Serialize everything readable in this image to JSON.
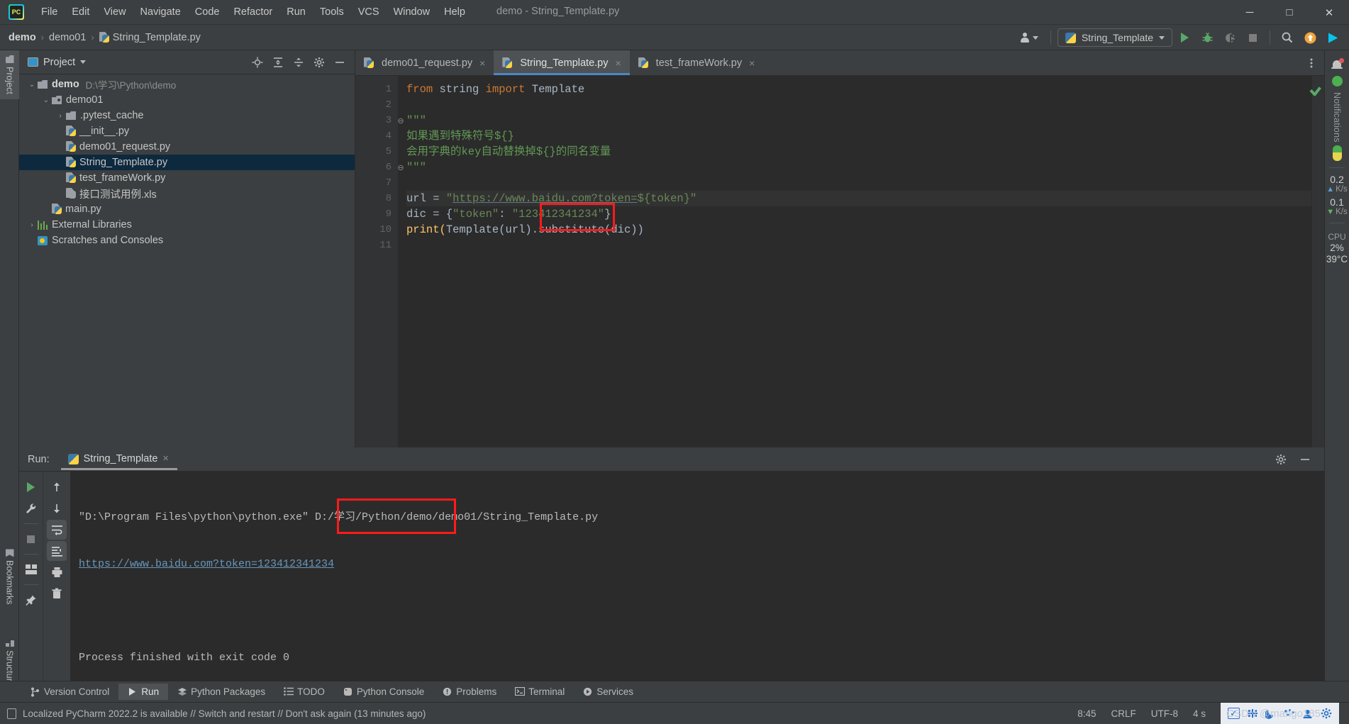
{
  "window": {
    "title": "demo - String_Template.py",
    "controls": {
      "minimize": "─",
      "maximize": "□",
      "close": "✕"
    }
  },
  "menu": {
    "items": [
      "File",
      "Edit",
      "View",
      "Navigate",
      "Code",
      "Refactor",
      "Run",
      "Tools",
      "VCS",
      "Window",
      "Help"
    ]
  },
  "navbar": {
    "breadcrumbs": [
      "demo",
      "demo01",
      "String_Template.py"
    ],
    "run_config": "String_Template",
    "icons": {
      "account": "account-icon",
      "run": "run-icon",
      "debug": "debug-icon",
      "coverage": "run-with-coverage-icon",
      "stop": "stop-icon",
      "search": "search-icon",
      "update": "update-icon",
      "plugin": "ide-features-trainer-icon"
    }
  },
  "left_strip": {
    "top": [
      {
        "label": "Project",
        "icon": "project-folder-icon",
        "active": true
      }
    ],
    "bottom": [
      {
        "label": "Bookmarks",
        "icon": "bookmark-icon",
        "active": false
      },
      {
        "label": "Structure",
        "icon": "structure-icon",
        "active": false
      }
    ]
  },
  "project_panel": {
    "title": "Project",
    "actions": [
      "locate-icon",
      "expand-all-icon",
      "collapse-all-icon",
      "gear-icon",
      "hide-icon"
    ],
    "tree": [
      {
        "depth": 0,
        "arrow": "⌄",
        "icon": "folder",
        "name": "demo",
        "bold": true,
        "path": "D:\\学习\\Python\\demo",
        "selected": false
      },
      {
        "depth": 1,
        "arrow": "⌄",
        "icon": "folder-source",
        "name": "demo01",
        "bold": false,
        "path": "",
        "selected": false
      },
      {
        "depth": 2,
        "arrow": "›",
        "icon": "folder",
        "name": ".pytest_cache",
        "bold": false,
        "path": "",
        "selected": false
      },
      {
        "depth": 2,
        "arrow": "",
        "icon": "python-file",
        "name": "__init__.py",
        "bold": false,
        "path": "",
        "selected": false
      },
      {
        "depth": 2,
        "arrow": "",
        "icon": "python-file",
        "name": "demo01_request.py",
        "bold": false,
        "path": "",
        "selected": false
      },
      {
        "depth": 2,
        "arrow": "",
        "icon": "python-file",
        "name": "String_Template.py",
        "bold": false,
        "path": "",
        "selected": true
      },
      {
        "depth": 2,
        "arrow": "",
        "icon": "python-file",
        "name": "test_frameWork.py",
        "bold": false,
        "path": "",
        "selected": false
      },
      {
        "depth": 2,
        "arrow": "",
        "icon": "unknown-file",
        "name": "接口测试用例.xls",
        "bold": false,
        "path": "",
        "selected": false
      },
      {
        "depth": 1,
        "arrow": "",
        "icon": "python-file",
        "name": "main.py",
        "bold": false,
        "path": "",
        "selected": false
      },
      {
        "depth": 0,
        "arrow": "›",
        "icon": "library",
        "name": "External Libraries",
        "bold": false,
        "path": "",
        "selected": false
      },
      {
        "depth": 0,
        "arrow": "",
        "icon": "scratch",
        "name": "Scratches and Consoles",
        "bold": false,
        "path": "",
        "selected": false
      }
    ]
  },
  "editor": {
    "tabs": [
      {
        "label": "demo01_request.py",
        "active": false
      },
      {
        "label": "String_Template.py",
        "active": true
      },
      {
        "label": "test_frameWork.py",
        "active": false
      }
    ],
    "close_glyph": "×",
    "line_numbers": [
      "1",
      "2",
      "3",
      "4",
      "5",
      "6",
      "7",
      "8",
      "9",
      "10",
      "11"
    ],
    "lines": [
      {
        "n": 1,
        "segments": [
          {
            "t": "from ",
            "c": "k"
          },
          {
            "t": "string ",
            "c": "def"
          },
          {
            "t": "import ",
            "c": "k"
          },
          {
            "t": "Template",
            "c": "def"
          }
        ]
      },
      {
        "n": 2,
        "segments": []
      },
      {
        "n": 3,
        "segments": [
          {
            "t": "\"\"\"",
            "c": "cmt"
          }
        ]
      },
      {
        "n": 4,
        "segments": [
          {
            "t": "如果遇到特殊符号${}",
            "c": "cmt"
          }
        ]
      },
      {
        "n": 5,
        "segments": [
          {
            "t": "会用字典的key自动替换掉${}的同名变量",
            "c": "cmt"
          }
        ]
      },
      {
        "n": 6,
        "segments": [
          {
            "t": "\"\"\"",
            "c": "cmt"
          }
        ]
      },
      {
        "n": 7,
        "segments": []
      },
      {
        "n": 8,
        "segments": [
          {
            "t": "url ",
            "c": "def"
          },
          {
            "t": "= ",
            "c": "def"
          },
          {
            "t": "\"",
            "c": "s"
          },
          {
            "t": "https://www.baidu.com?token=",
            "c": "lnk"
          },
          {
            "t": "${token}\"",
            "c": "s"
          }
        ],
        "current": true
      },
      {
        "n": 9,
        "segments": [
          {
            "t": "dic ",
            "c": "def"
          },
          {
            "t": "= {",
            "c": "def"
          },
          {
            "t": "\"token\"",
            "c": "s"
          },
          {
            "t": ": ",
            "c": "def"
          },
          {
            "t": "\"123412341234\"",
            "c": "s"
          },
          {
            "t": "}",
            "c": "def"
          }
        ]
      },
      {
        "n": 10,
        "segments": [
          {
            "t": "print(",
            "c": "fn"
          },
          {
            "t": "Template(url).substitute(dic))",
            "c": "def"
          }
        ]
      },
      {
        "n": 11,
        "segments": []
      }
    ],
    "fold_markers": {
      "line3": "⊖",
      "line6": "⊖"
    },
    "inspection_status": "ok-check-icon",
    "highlight_box_label": "${token}"
  },
  "run_window": {
    "label": "Run:",
    "tab": "String_Template",
    "tab_close": "×",
    "header_actions": [
      "gear-icon",
      "hide-icon"
    ],
    "left_tools": [
      "rerun-icon",
      "wrench-icon",
      "stop-icon",
      "layout-icon",
      "pin-icon"
    ],
    "right_tools": [
      "up-icon",
      "down-icon",
      "soft-wrap-icon",
      "scroll-to-end-icon",
      "print-icon",
      "trash-icon"
    ],
    "console": {
      "line1": "\"D:\\Program Files\\python\\python.exe\" D:/学习/Python/demo/demo01/String_Template.py",
      "line2_link": "https://www.baidu.com?token=",
      "line2_value": "123412341234",
      "line3": "Process finished with exit code 0"
    }
  },
  "right_strip": {
    "notifications_label": "Notifications",
    "network_up_value": "0.2",
    "network_up_unit": "K/s",
    "network_down_value": "0.1",
    "network_down_unit": "K/s",
    "cpu_label": "CPU",
    "cpu_value": "2%",
    "temperature": "39°C"
  },
  "bottom_bar": {
    "items": [
      {
        "label": "Version Control",
        "icon": "branch-icon",
        "active": false
      },
      {
        "label": "Run",
        "icon": "run-icon",
        "active": true
      },
      {
        "label": "Python Packages",
        "icon": "packages-icon",
        "active": false
      },
      {
        "label": "TODO",
        "icon": "todo-icon",
        "active": false
      },
      {
        "label": "Python Console",
        "icon": "python-console-icon",
        "active": false
      },
      {
        "label": "Problems",
        "icon": "problems-icon",
        "active": false
      },
      {
        "label": "Terminal",
        "icon": "terminal-icon",
        "active": false
      },
      {
        "label": "Services",
        "icon": "services-icon",
        "active": false
      }
    ]
  },
  "status_bar": {
    "message": "Localized PyCharm 2022.2 is available // Switch and restart // Don't ask again (13 minutes ago)",
    "time": "8:45",
    "line_separator": "CRLF",
    "encoding": "UTF-8",
    "indent": "4 s",
    "tray_icons": [
      "checkbox-icon",
      "network-icon",
      "moon-icon",
      "dots-icon",
      "user-icon",
      "gear-icon"
    ],
    "watermark": "CSDN @mango185"
  },
  "colors": {
    "background": "#3c3f41",
    "editor_background": "#2b2b2b",
    "accent_blue": "#4a88c7",
    "selection": "#0d293e",
    "highlight_red": "#ff1a1a",
    "string_green": "#6a8759",
    "keyword_orange": "#cc7832",
    "function_yellow": "#ffc66d",
    "link_blue": "#6897bb"
  }
}
